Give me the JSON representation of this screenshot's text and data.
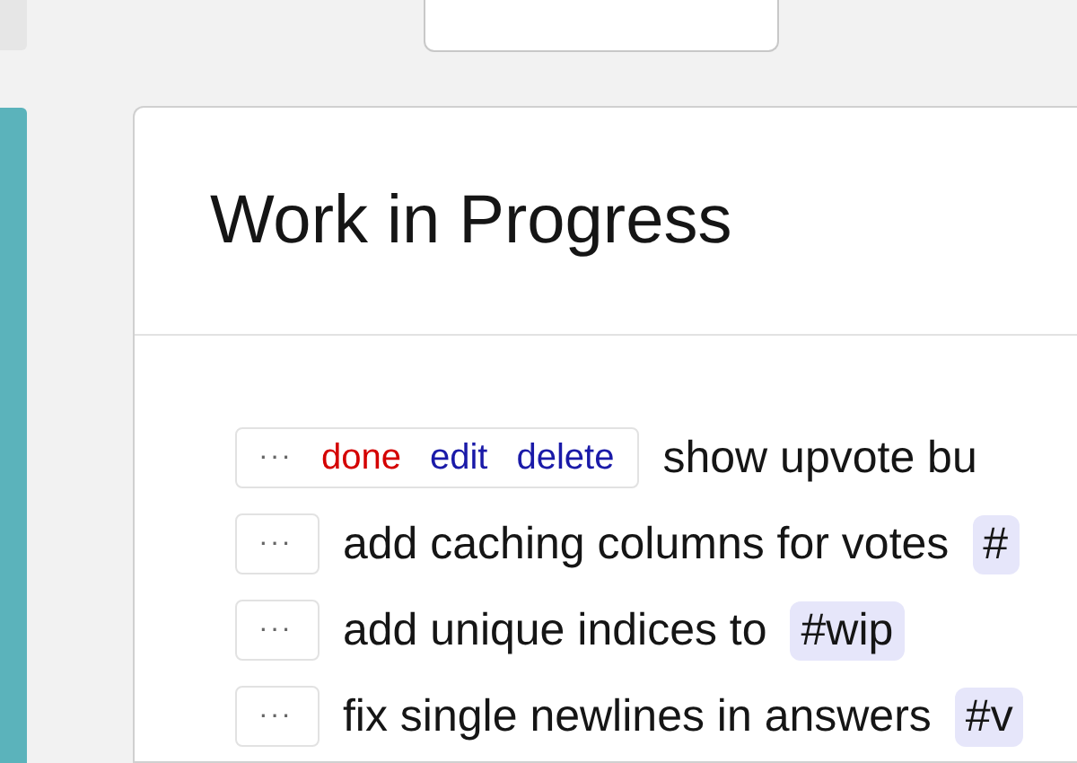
{
  "card": {
    "title": "Work in Progress"
  },
  "tasks": [
    {
      "menu": "···",
      "expanded": true,
      "actions": [
        {
          "label": "done",
          "kind": "done"
        },
        {
          "label": "edit",
          "kind": "edit"
        },
        {
          "label": "delete",
          "kind": "delete"
        }
      ],
      "text": "show upvote bu"
    },
    {
      "menu": "···",
      "expanded": false,
      "text": "add caching columns for votes",
      "tag": "#"
    },
    {
      "menu": "···",
      "expanded": false,
      "text": "add unique indices to",
      "tag": "#wip"
    },
    {
      "menu": "···",
      "expanded": false,
      "text": "fix single newlines in answers",
      "tag": "#v"
    }
  ]
}
